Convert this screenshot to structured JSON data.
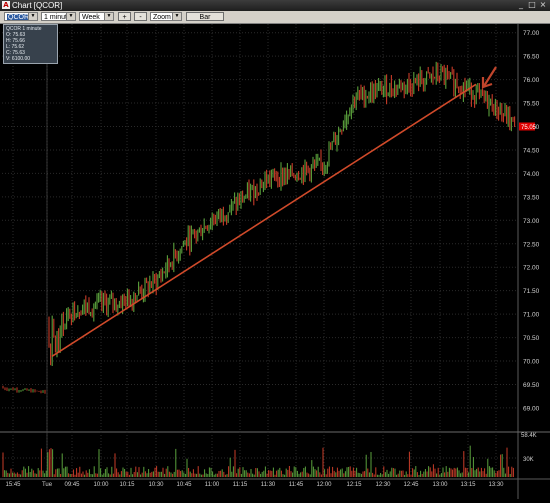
{
  "window": {
    "title": "Chart [QCOR]",
    "icon": "app-icon",
    "buttons": [
      "minimize-icon",
      "maximize-icon",
      "close-icon"
    ]
  },
  "toolbar": {
    "symbol": "QCOR",
    "interval": "1 minute",
    "period": "Week",
    "zoom_in_label": "+",
    "zoom_out_label": "-",
    "zoom": "Zoom",
    "chart_type": "Bar"
  },
  "ohlc_panel": {
    "symbol_line": "QCOR 1 minute",
    "open": "O: 75.63",
    "high": "H: 75.66",
    "low": "L: 75.62",
    "close": "C: 75.63",
    "volume": "V: 6100.00"
  },
  "colors": {
    "up": "#5aa03c",
    "down": "#c83c28",
    "trendline": "#d04a2a",
    "arrow": "#c0452c",
    "price_tag": "#e00000",
    "axis_text": "#d0d0d0"
  },
  "chart_data": {
    "type": "bar",
    "symbol": "QCOR",
    "price_axis_ticks": [
      77.0,
      76.5,
      76.0,
      75.5,
      75.0,
      74.5,
      74.0,
      73.5,
      73.0,
      72.5,
      72.0,
      71.5,
      71.0,
      70.5,
      70.0,
      69.5,
      69.0
    ],
    "price_ylim": [
      68.7,
      77.1
    ],
    "last_price_label": "75.05",
    "volume_axis_ticks": [
      "30K"
    ],
    "volume_top_label": "58.4K",
    "time_axis_labels": [
      "15:45",
      "Tue",
      "09:45",
      "10:00",
      "10:15",
      "10:30",
      "10:45",
      "11:00",
      "11:15",
      "11:30",
      "11:45",
      "12:00",
      "12:15",
      "12:30",
      "12:45",
      "13:00",
      "13:15",
      "13:30"
    ],
    "price_path_keypoints": [
      {
        "t": "15:45",
        "price": 69.4
      },
      {
        "t": "Tue open",
        "price": 70.4
      },
      {
        "t": "09:45",
        "price": 71.1
      },
      {
        "t": "10:00",
        "price": 71.2
      },
      {
        "t": "10:15",
        "price": 71.3
      },
      {
        "t": "10:30",
        "price": 71.7
      },
      {
        "t": "10:45",
        "price": 72.5
      },
      {
        "t": "11:00",
        "price": 73.0
      },
      {
        "t": "11:15",
        "price": 73.4
      },
      {
        "t": "11:30",
        "price": 73.9
      },
      {
        "t": "11:45",
        "price": 74.0
      },
      {
        "t": "12:00",
        "price": 74.2
      },
      {
        "t": "12:15",
        "price": 75.6
      },
      {
        "t": "12:30",
        "price": 75.8
      },
      {
        "t": "12:45",
        "price": 75.9
      },
      {
        "t": "13:00",
        "price": 76.1
      },
      {
        "t": "13:15",
        "price": 75.8
      },
      {
        "t": "13:30",
        "price": 75.4
      },
      {
        "t": "close",
        "price": 75.05
      }
    ],
    "trendline": {
      "from": {
        "t": "Tue open",
        "price": 70.1
      },
      "to": {
        "t": "13:15",
        "price": 75.9
      }
    },
    "annotation": "arrow pointing to trendline break near 13:15",
    "grid": true,
    "legend": "none"
  }
}
